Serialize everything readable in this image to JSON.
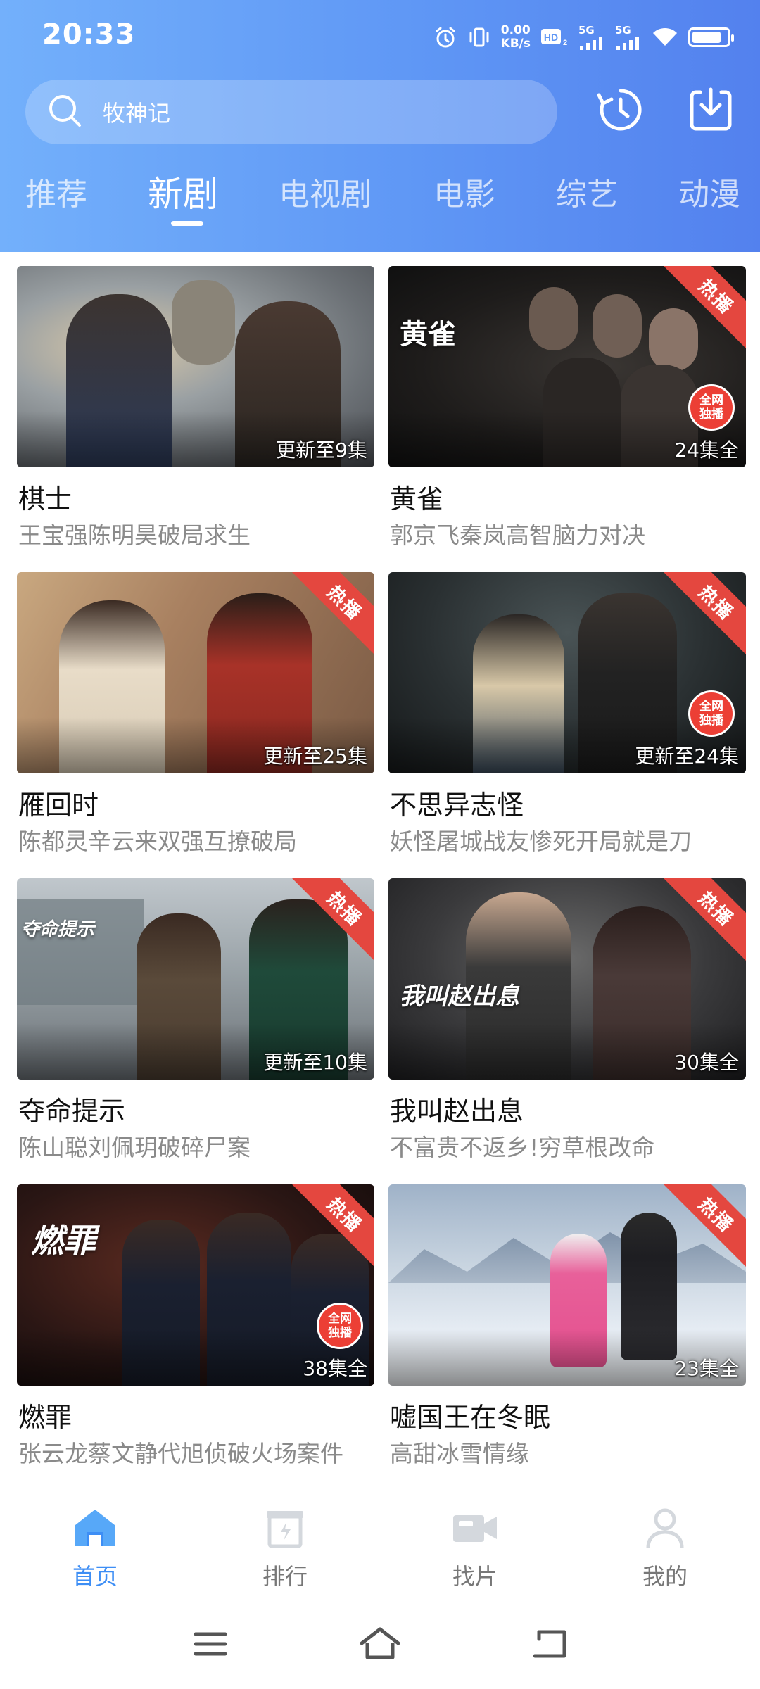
{
  "status_bar": {
    "time": "20:33",
    "net_speed_value": "0.00",
    "net_speed_unit": "KB/s",
    "hd_label": "HD",
    "sim1_label": "5G",
    "sim2_label": "5G"
  },
  "search": {
    "value": "牧神记"
  },
  "tabs": [
    "推荐",
    "新剧",
    "电视剧",
    "电影",
    "综艺",
    "动漫"
  ],
  "active_tab_index": 1,
  "shows": [
    {
      "title": "棋士",
      "subtitle": "王宝强陈明昊破局求生",
      "badge": "更新至9集",
      "hot": false,
      "exclusive": false
    },
    {
      "title": "黄雀",
      "subtitle": "郭京飞秦岚高智脑力对决",
      "badge": "24集全",
      "hot": true,
      "exclusive": true,
      "poster_logo": "黄雀"
    },
    {
      "title": "雁回时",
      "subtitle": "陈都灵辛云来双强互撩破局",
      "badge": "更新至25集",
      "hot": true,
      "exclusive": false
    },
    {
      "title": "不思异志怪",
      "subtitle": "妖怪屠城战友惨死开局就是刀",
      "badge": "更新至24集",
      "hot": true,
      "exclusive": true
    },
    {
      "title": "夺命提示",
      "subtitle": "陈山聪刘佩玥破碎尸案",
      "badge": "更新至10集",
      "hot": true,
      "exclusive": false,
      "poster_logo": "夺命提示"
    },
    {
      "title": "我叫赵出息",
      "subtitle": "不富贵不返乡!穷草根改命",
      "badge": "30集全",
      "hot": true,
      "exclusive": true,
      "poster_logo": "我叫赵出息"
    },
    {
      "title": "燃罪",
      "subtitle": "张云龙蔡文静代旭侦破火场案件",
      "badge": "38集全",
      "hot": true,
      "exclusive": true,
      "poster_logo": "燃罪"
    },
    {
      "title": "嘘国王在冬眠",
      "subtitle": "高甜冰雪情缘",
      "badge": "23集全",
      "hot": true,
      "exclusive": false
    }
  ],
  "ribbon_text": "热播",
  "exclusive_text_1": "全网",
  "exclusive_text_2": "独播",
  "bottom_nav": [
    {
      "label": "首页",
      "icon": "home-icon"
    },
    {
      "label": "排行",
      "icon": "ranking-icon"
    },
    {
      "label": "找片",
      "icon": "video-camera-icon"
    },
    {
      "label": "我的",
      "icon": "user-icon"
    }
  ],
  "colors": {
    "header_start": "#73b0fb",
    "header_end": "#5381ee",
    "nav_active": "#3d8ef5",
    "ribbon": "#e4473f"
  }
}
